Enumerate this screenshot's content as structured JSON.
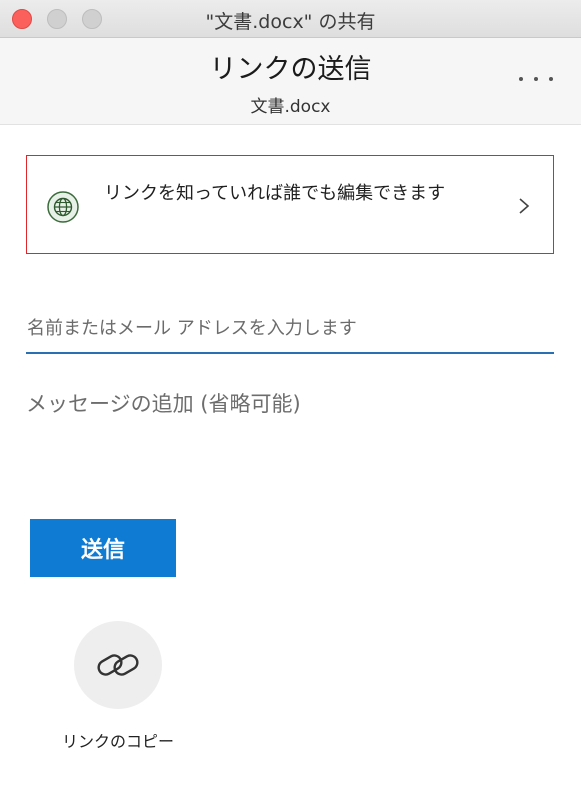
{
  "window": {
    "title": "\"文書.docx\" の共有"
  },
  "header": {
    "title": "リンクの送信",
    "subtitle": "文書.docx",
    "more_icon": "more-horizontal-icon"
  },
  "permission": {
    "icon": "globe-icon",
    "text": "リンクを知っていれば誰でも編集できます",
    "accent_border": "#e0262a"
  },
  "recipients": {
    "placeholder": "名前またはメール アドレスを入力します",
    "value": ""
  },
  "message": {
    "placeholder": "メッセージの追加 (省略可能)",
    "value": ""
  },
  "send": {
    "label": "送信",
    "color": "#0f7bd3"
  },
  "copy_link": {
    "icon": "link-icon",
    "label": "リンクのコピー"
  }
}
